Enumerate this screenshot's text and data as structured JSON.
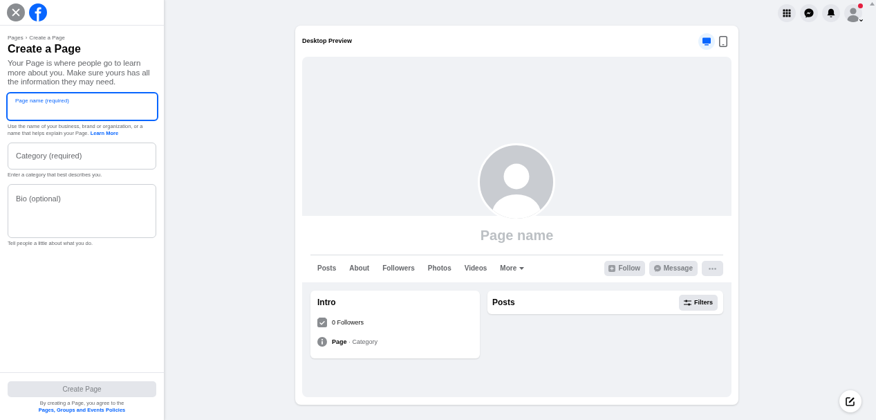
{
  "top_bar": {
    "account_alert": true
  },
  "sidebar": {
    "breadcrumb": {
      "items": [
        "Pages",
        "Create a Page"
      ],
      "separator": "›"
    },
    "title": "Create a Page",
    "description": "Your Page is where people go to learn more about you. Make sure yours has all the information they may need.",
    "fields": [
      {
        "kind": "input",
        "placeholder": "Page name (required)",
        "focused": true,
        "helper": "Use the name of your business, brand or organization, or a name that helps explain your Page.",
        "helper_link": "Learn More"
      },
      {
        "kind": "input",
        "placeholder": "Category (required)",
        "focused": false,
        "helper": "Enter a category that best describes you."
      },
      {
        "kind": "textarea",
        "placeholder": "Bio (optional)",
        "focused": false,
        "helper": "Tell people a little about what you do."
      }
    ],
    "create_button": {
      "label": "Create Page",
      "disabled": true
    },
    "terms": {
      "text": "By creating a Page, you agree to the",
      "link": "Pages, Groups and Events Policies"
    }
  },
  "preview": {
    "title": "Desktop Preview",
    "modes": [
      {
        "kind": "desktop",
        "selected": true
      },
      {
        "kind": "mobile",
        "selected": false
      }
    ],
    "page_name": "Page name",
    "tabs": [
      {
        "label": "Posts",
        "dropdown": false
      },
      {
        "label": "About",
        "dropdown": false
      },
      {
        "label": "Followers",
        "dropdown": false
      },
      {
        "label": "Photos",
        "dropdown": false
      },
      {
        "label": "Videos",
        "dropdown": false
      },
      {
        "label": "More",
        "dropdown": true
      }
    ],
    "actions": [
      {
        "kind": "follow",
        "label": "Follow",
        "disabled": true
      },
      {
        "kind": "message",
        "label": "Message",
        "disabled": true
      },
      {
        "kind": "more",
        "disabled": true
      }
    ],
    "intro": {
      "title": "Intro",
      "items": [
        {
          "kind": "followers",
          "text": "0 Followers"
        },
        {
          "kind": "info",
          "text": "**Page** · Category"
        }
      ]
    },
    "posts": {
      "title": "Posts",
      "filter_button": "Filters"
    }
  }
}
